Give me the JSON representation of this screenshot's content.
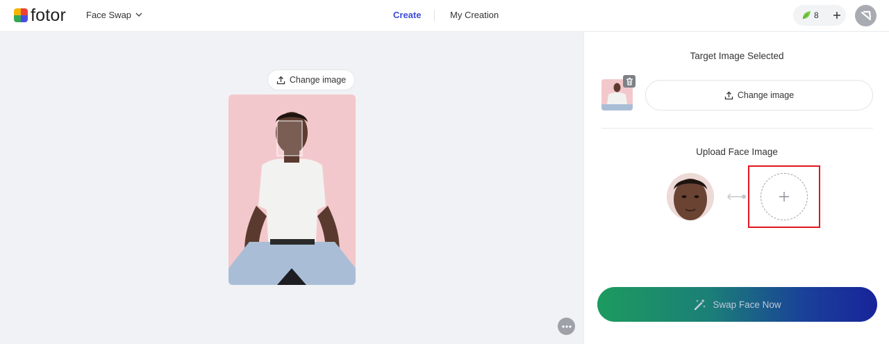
{
  "header": {
    "brand": "fotor",
    "product": "Face Swap",
    "nav": {
      "create": "Create",
      "my_creation": "My Creation"
    },
    "credits": "8"
  },
  "canvas": {
    "change_image_label": "Change image"
  },
  "panel": {
    "target_title": "Target Image Selected",
    "change_image_label": "Change image",
    "upload_title": "Upload Face Image",
    "swap_label": "Swap Face Now"
  },
  "colors": {
    "accent": "#3b4bd8",
    "highlight": "#e0161e",
    "swap_start": "#1c9b5e",
    "swap_end": "#18249a"
  }
}
